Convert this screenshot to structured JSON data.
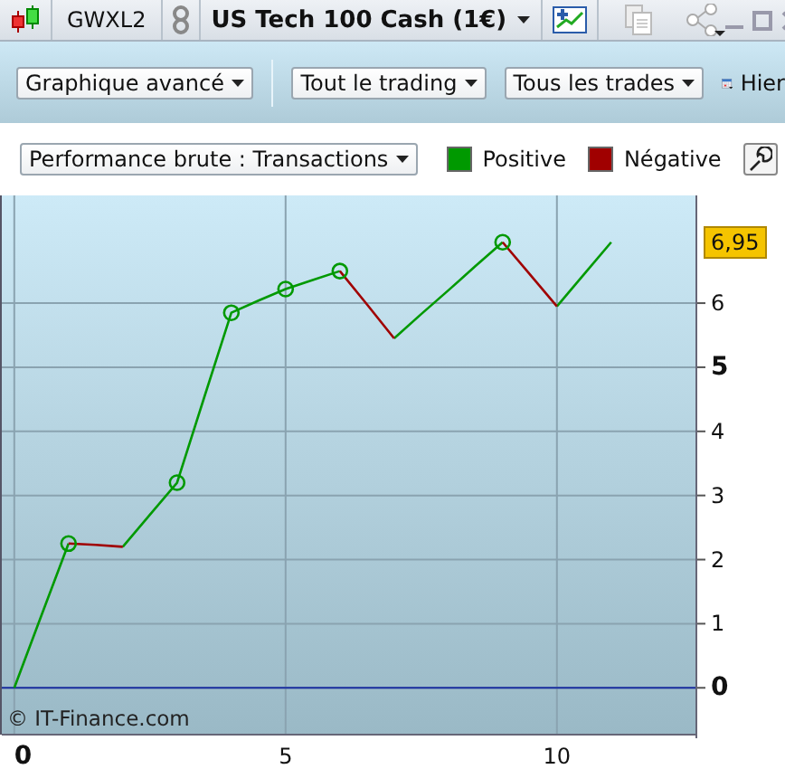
{
  "header": {
    "account": "GWXL2",
    "instrument": "US Tech 100 Cash (1€)"
  },
  "toolbar": {
    "dropdowns": [
      "Graphique avancé",
      "Tout le trading",
      "Tous les trades"
    ],
    "date_label": "Hier"
  },
  "chart_panel": {
    "metric": "Performance brute : Transactions",
    "last_value": "6,95",
    "copyright": "© IT-Finance.com",
    "chart_data": {
      "type": "line",
      "x": [
        0,
        0.5,
        1,
        1.5,
        2,
        2.5,
        3,
        3.5,
        4,
        4.5,
        5,
        5.5,
        6,
        6.5,
        7,
        7.5,
        8,
        8.5,
        9,
        9.5,
        10,
        10.5,
        11
      ],
      "series": [
        {
          "name": "Positive",
          "color": "#009900",
          "values": [
            0,
            1.13,
            2.25,
            null,
            2.2,
            2.7,
            3.2,
            4.53,
            5.85,
            6.04,
            6.22,
            6.36,
            6.5,
            null,
            5.45,
            5.83,
            6.2,
            6.58,
            6.95,
            null,
            5.95,
            6.45,
            6.95
          ]
        },
        {
          "name": "Négative",
          "color": "#a00000",
          "values": [
            null,
            null,
            2.25,
            2.23,
            2.2,
            null,
            null,
            null,
            null,
            null,
            null,
            null,
            6.5,
            5.98,
            5.45,
            null,
            null,
            null,
            6.95,
            6.45,
            5.95,
            null,
            null
          ]
        }
      ],
      "grid": true,
      "ref_lines": [
        {
          "axis": "y",
          "value": 0,
          "color": "#1a2fa0"
        }
      ],
      "xlim": [
        -0.23,
        12.57
      ],
      "ylim": [
        -0.73,
        7.68
      ],
      "xticks": [
        0,
        5,
        10
      ],
      "yticks": [
        0,
        1,
        2,
        3,
        4,
        5,
        6
      ]
    }
  }
}
